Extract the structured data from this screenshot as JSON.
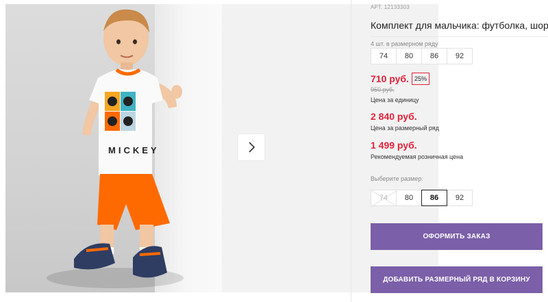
{
  "product": {
    "sku": "АРТ. 12133303",
    "title": "Комплект для мальчика: футболка, шорты"
  },
  "size_range": {
    "caption": "4 шт. в размерном ряду",
    "sizes": [
      "74",
      "80",
      "86",
      "92"
    ]
  },
  "pricing": {
    "unit_price": "710 руб.",
    "discount": "25%",
    "old_price": "950 руб.",
    "unit_caption": "Цена за единицу",
    "range_price": "2 840 руб.",
    "range_caption": "Цена за размерный ряд",
    "rrp_price": "1 499 руб.",
    "rrp_caption": "Рекомендуемая розничная цена"
  },
  "size_picker": {
    "label": "Выберите размер:",
    "sizes": [
      {
        "label": "74",
        "state": "unavailable"
      },
      {
        "label": "80",
        "state": "available"
      },
      {
        "label": "86",
        "state": "selected"
      },
      {
        "label": "92",
        "state": "available"
      }
    ]
  },
  "actions": {
    "order_label": "ОФОРМИТЬ ЗАКАЗ",
    "add_range_label": "ДОБАВИТЬ РАЗМЕРНЫЙ РЯД В КОРЗИНУ"
  },
  "gallery": {
    "image_alt_icon": "product-photo",
    "next_icon": "chevron-right-icon",
    "tshirt_print_text": "MICKEY"
  },
  "colors": {
    "price_red": "#e2223a",
    "button_purple": "#7b5fa8",
    "shorts_orange": "#ff6a00"
  }
}
